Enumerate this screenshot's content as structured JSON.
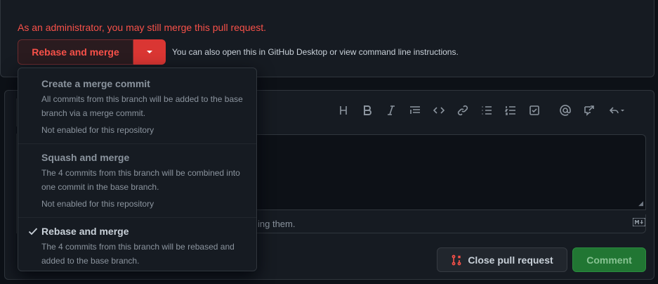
{
  "merge": {
    "admin_text": "As an administrator, you may still merge this pull request.",
    "button_label": "Rebase and merge",
    "also_prefix": "You can also",
    "open_link": "open this in GitHub Desktop",
    "or_text": "or",
    "view_link": "view command line instructions",
    "period": "."
  },
  "dropdown": {
    "items": [
      {
        "title": "Create a merge commit",
        "description": "All commits from this branch will be added to the base branch via a merge commit.",
        "note": "Not enabled for this repository",
        "selected": false
      },
      {
        "title": "Squash and merge",
        "description": "The 4 commits from this branch will be combined into one commit in the base branch.",
        "note": "Not enabled for this repository",
        "selected": false
      },
      {
        "title": "Rebase and merge",
        "description": "The 4 commits from this branch will be rebased and added to the base branch.",
        "note": "",
        "selected": true
      }
    ]
  },
  "toolbar": {
    "icons": [
      "heading-icon",
      "bold-icon",
      "italic-icon",
      "quote-icon",
      "code-icon",
      "link-icon",
      "bulleted-list-icon",
      "numbered-list-icon",
      "task-list-icon",
      "mention-icon",
      "cross-reference-icon",
      "saved-reply-icon"
    ]
  },
  "comment": {
    "hint_text": "ing them.",
    "close_label": "Close pull request",
    "comment_label": "Comment"
  },
  "colors": {
    "danger": "#f85149",
    "danger_solid": "#da3633",
    "success": "#238636",
    "background": "#0d1117"
  }
}
